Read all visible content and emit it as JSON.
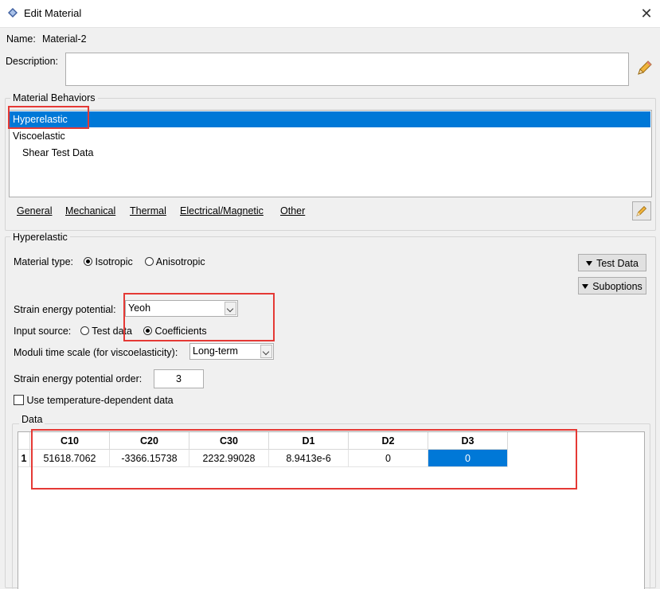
{
  "window": {
    "title": "Edit Material"
  },
  "name": {
    "label": "Name:",
    "value": "Material-2"
  },
  "description": {
    "label": "Description:",
    "value": ""
  },
  "behaviors": {
    "label": "Material Behaviors",
    "items": [
      {
        "label": "Hyperelastic",
        "selected": true
      },
      {
        "label": "Viscoelastic",
        "selected": false
      },
      {
        "label": "Shear Test Data",
        "selected": false
      }
    ]
  },
  "menu": [
    "General",
    "Mechanical",
    "Thermal",
    "Electrical/Magnetic",
    "Other"
  ],
  "hyperelastic": {
    "label": "Hyperelastic",
    "material_type": {
      "label": "Material type:",
      "options": [
        "Isotropic",
        "Anisotropic"
      ],
      "selected": "Isotropic"
    },
    "test_data_button": "Test Data",
    "suboptions_button": "Suboptions",
    "strain_energy": {
      "label": "Strain energy potential:",
      "value": "Yeoh"
    },
    "input_source": {
      "label": "Input source:",
      "options": [
        "Test data",
        "Coefficients"
      ],
      "selected": "Coefficients"
    },
    "moduli": {
      "label": "Moduli time scale (for viscoelasticity):",
      "value": "Long-term"
    },
    "order": {
      "label": "Strain energy potential order:",
      "value": "3"
    },
    "temp_dependent": {
      "label": "Use temperature-dependent data",
      "checked": false
    }
  },
  "data": {
    "label": "Data",
    "columns": [
      "C10",
      "C20",
      "C30",
      "D1",
      "D2",
      "D3"
    ],
    "rows": [
      {
        "index": "1",
        "values": [
          "51618.7062",
          "-3366.15738",
          "2232.99028",
          "8.9413e-6",
          "0",
          "0"
        ]
      }
    ]
  },
  "colors": {
    "selection": "#0078d7",
    "highlight": "#e53935"
  }
}
